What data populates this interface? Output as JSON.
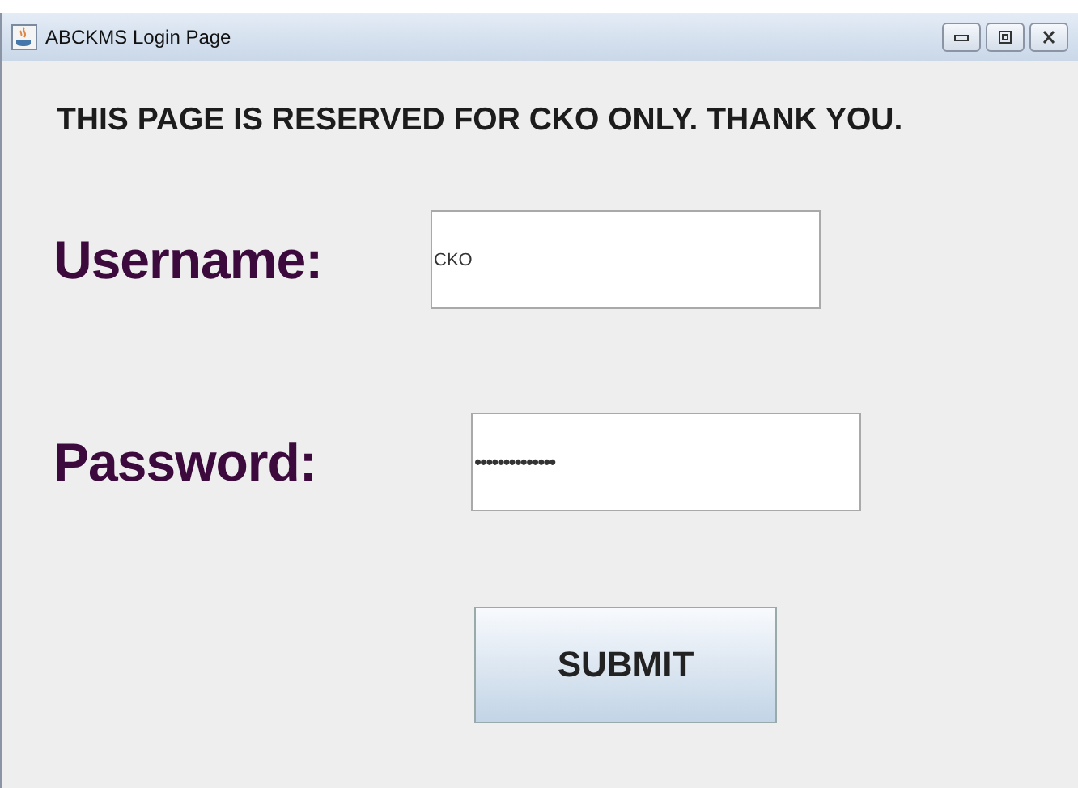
{
  "window": {
    "title": "ABCKMS Login Page"
  },
  "notice": "THIS PAGE IS RESERVED FOR CKO ONLY. THANK YOU.",
  "fields": [
    {
      "label": "Username:",
      "value": "CKO"
    },
    {
      "label": "Password:",
      "value": "••••••••••••••"
    }
  ],
  "buttons": [
    "SUBMIT"
  ]
}
